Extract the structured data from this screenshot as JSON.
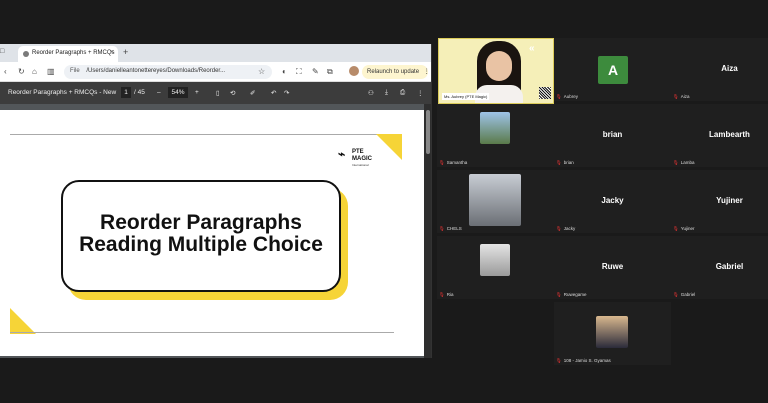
{
  "browser": {
    "tab_title": "Reorder Paragraphs + RMCQs",
    "new_tab": "+",
    "window_btn": "□",
    "address_scheme": "File",
    "address_path": "/Users/danielleantonettereyes/Downloads/Reorder...",
    "relaunch_label": "Relaunch to update",
    "relaunch_menu": "⋮"
  },
  "pdf_toolbar": {
    "doc_title": "Reorder Paragraphs + RMCQs - New",
    "page_current": "1",
    "page_total": "/ 45",
    "zoom": "54%",
    "zoom_out": "–",
    "zoom_in": "+"
  },
  "slide": {
    "line1": "Reorder Paragraphs",
    "line2": "Reading Multiple Choice",
    "logo_line1": "PTE",
    "logo_line2": "MAGIC",
    "logo_line3": "International",
    "accent_color": "#f6d437"
  },
  "participants": {
    "main_cam": {
      "name": "Aubrey",
      "tag": "Ms. Aubrey (PTE Magic)"
    },
    "tiles": [
      {
        "display": "A",
        "label": "Aubrey"
      },
      {
        "display": "Aiza",
        "label": "Aiza"
      },
      {
        "display": "",
        "label": "Samantha"
      },
      {
        "display": "brian",
        "label": "brian"
      },
      {
        "display": "Lambearth",
        "label": "Lamba"
      },
      {
        "display": "",
        "label": "CHELS"
      },
      {
        "display": "Jacky",
        "label": "Jacky"
      },
      {
        "display": "Yujiner",
        "label": "Yujiner"
      },
      {
        "display": "",
        "label": "Ria"
      },
      {
        "display": "Ruwe",
        "label": "Ruwegame"
      },
      {
        "display": "Gabriel",
        "label": "Gabriel"
      },
      {
        "display": "",
        "label": "108 - Jamio S. Gyamas"
      }
    ]
  }
}
